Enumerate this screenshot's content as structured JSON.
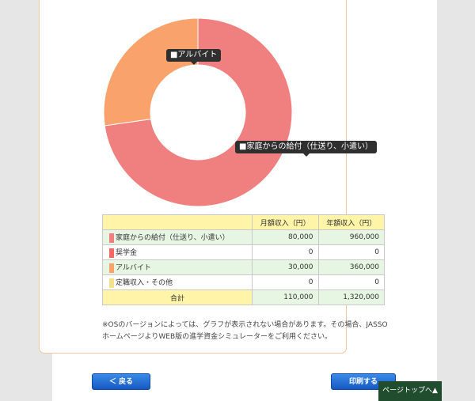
{
  "chart_data": {
    "type": "pie",
    "variant": "donut",
    "categories": [
      "家庭からの給付（仕送り、小遣い）",
      "奨学金",
      "アルバイト",
      "定職収入・その他"
    ],
    "values": [
      80000,
      0,
      30000,
      0
    ],
    "colors": [
      "#f08080",
      "#f46a62",
      "#f9a26c",
      "#f4e18a"
    ],
    "tooltips": [
      "■アルバイト",
      "■家庭からの給付（仕送り、小遣い）"
    ]
  },
  "table": {
    "headers": [
      "",
      "月額収入（円）",
      "年額収入（円）"
    ],
    "rows": [
      {
        "label": "家庭からの給付（仕送り、小遣い）",
        "color": "#f08080",
        "monthly": "80,000",
        "annual": "960,000"
      },
      {
        "label": "奨学金",
        "color": "#f46a62",
        "monthly": "0",
        "annual": "0"
      },
      {
        "label": "アルバイト",
        "color": "#f9a26c",
        "monthly": "30,000",
        "annual": "360,000"
      },
      {
        "label": "定職収入・その他",
        "color": "#f4e18a",
        "monthly": "0",
        "annual": "0"
      }
    ],
    "total": {
      "label": "合計",
      "monthly": "110,000",
      "annual": "1,320,000"
    }
  },
  "note": "※OSのバージョンによっては、グラフが表示されない場合があります。その場合、JASSOホームページよりWEB版の進学資金シミュレーターをご利用ください。",
  "buttons": {
    "back": "＜ 戻る",
    "print": "印刷する"
  },
  "pagetop": "ページトップへ▲"
}
